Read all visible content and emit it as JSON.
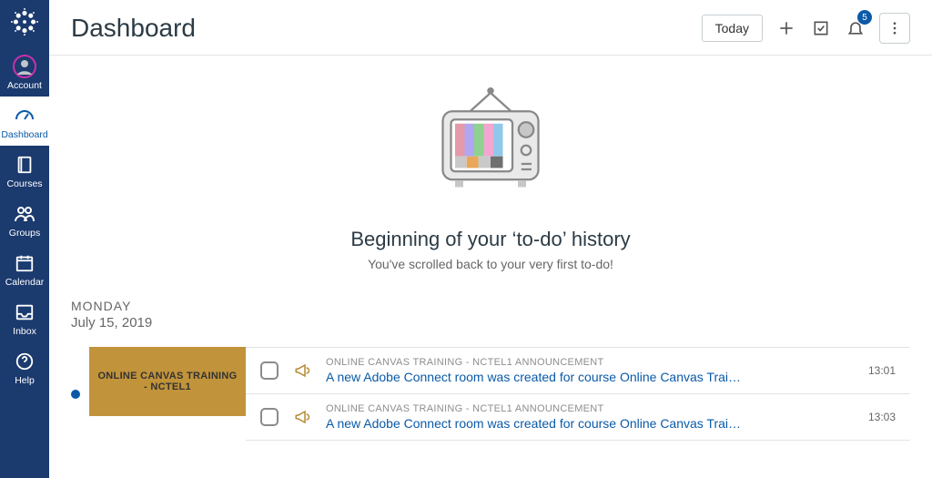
{
  "colors": {
    "sidebar": "#1b3a6e",
    "link": "#0a5aa8",
    "course": "#c1933a"
  },
  "nav": {
    "items": [
      {
        "label": "Account"
      },
      {
        "label": "Dashboard"
      },
      {
        "label": "Courses"
      },
      {
        "label": "Groups"
      },
      {
        "label": "Calendar"
      },
      {
        "label": "Inbox"
      },
      {
        "label": "Help"
      }
    ]
  },
  "header": {
    "title": "Dashboard",
    "today_label": "Today",
    "notification_count": "5"
  },
  "empty": {
    "heading": "Beginning of your ‘to-do’ history",
    "sub": "You've scrolled back to your very first to-do!"
  },
  "day": {
    "weekday": "MONDAY",
    "date": "July 15, 2019",
    "course_label": "ONLINE CANVAS TRAINING - NCTEL1",
    "items": [
      {
        "meta": "ONLINE CANVAS TRAINING - NCTEL1 ANNOUNCEMENT",
        "title": "A new Adobe Connect room was created for course Online Canvas Trai…",
        "time": "13:01"
      },
      {
        "meta": "ONLINE CANVAS TRAINING - NCTEL1 ANNOUNCEMENT",
        "title": "A new Adobe Connect room was created for course Online Canvas Trai…",
        "time": "13:03"
      }
    ]
  }
}
